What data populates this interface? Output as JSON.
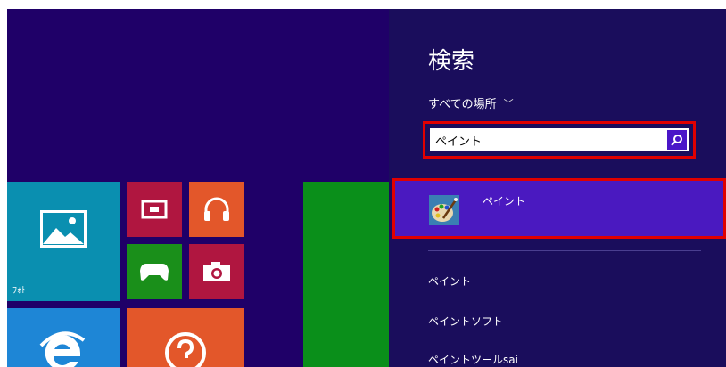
{
  "tiles": {
    "photos_label": "ﾌｫﾄ"
  },
  "search_charm": {
    "title": "検索",
    "scope_label": "すべての場所",
    "scope_chevron": "﹀",
    "query": "ペイント",
    "top_result": {
      "label": "ペイント",
      "icon": "paint-palette-icon"
    },
    "suggestions": [
      "ペイント",
      "ペイントソフト",
      "ペイントツールsai"
    ]
  },
  "colors": {
    "background": "#1f0068",
    "charm_background": "#1a0d5c",
    "selected_result": "#4a19c0",
    "highlight_border": "#e00000",
    "search_button": "#4a16c8"
  }
}
